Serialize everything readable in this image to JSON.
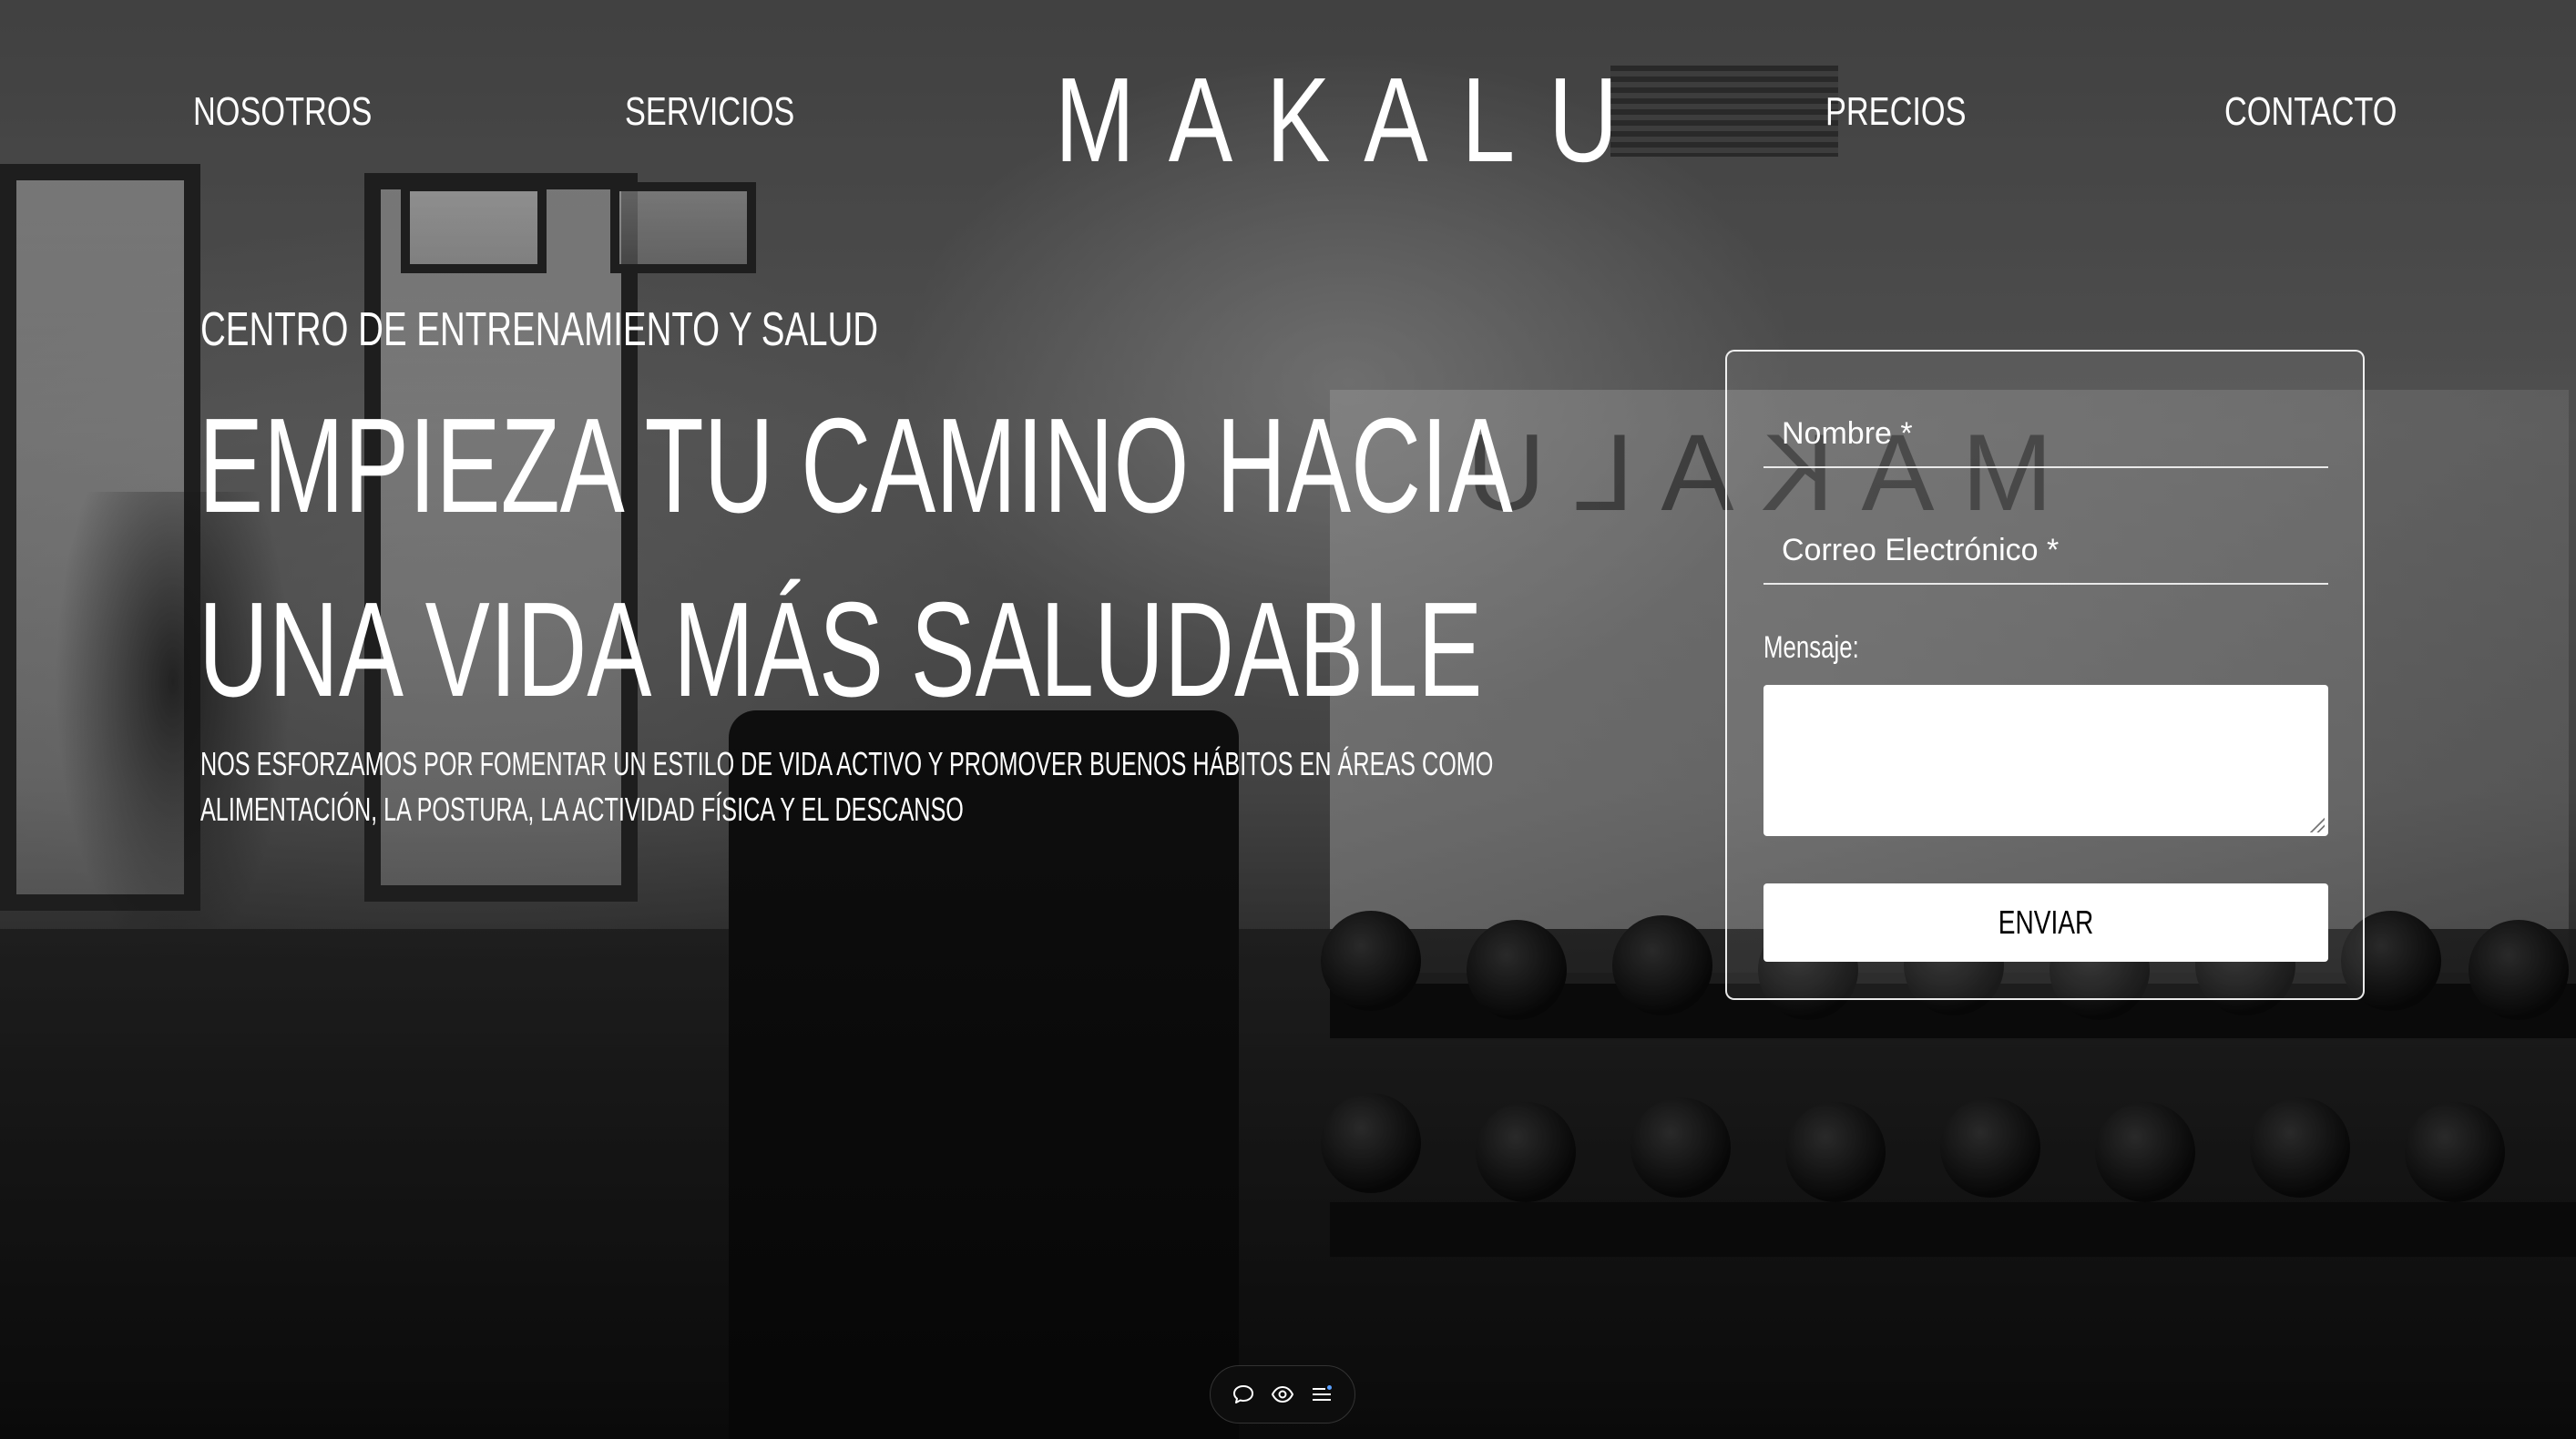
{
  "brand": {
    "logo_text": "MAKALU"
  },
  "nav": {
    "items": [
      {
        "label": "NOSOTROS"
      },
      {
        "label": "SERVICIOS"
      },
      {
        "label": "PRECIOS"
      },
      {
        "label": "CONTACTO"
      }
    ]
  },
  "hero": {
    "eyebrow": "CENTRO DE ENTRENAMIENTO Y SALUD",
    "title_line_1": "EMPIEZA TU CAMINO HACIA",
    "title_line_2": "UNA VIDA MÁS SALUDABLE",
    "description_line_1": "NOS ESFORZAMOS POR FOMENTAR UN ESTILO DE VIDA ACTIVO Y PROMOVER BUENOS HÁBITOS EN ÁREAS COMO",
    "description_line_2": "ALIMENTACIÓN, LA POSTURA, LA ACTIVIDAD FÍSICA Y EL DESCANSO"
  },
  "contact_form": {
    "name_placeholder": "Nombre *",
    "name_value": "",
    "email_placeholder": "Correo Electrónico *",
    "email_value": "",
    "message_label": "Mensaje:",
    "message_value": "",
    "submit_label": "ENVIAR"
  },
  "toolbar": {
    "icons": [
      "comment-icon",
      "eye-icon",
      "menu-list-icon"
    ]
  },
  "colors": {
    "text": "#ffffff",
    "button_bg": "#ffffff",
    "button_text": "#000000",
    "toolbar_bg": "#0d0d0d"
  }
}
